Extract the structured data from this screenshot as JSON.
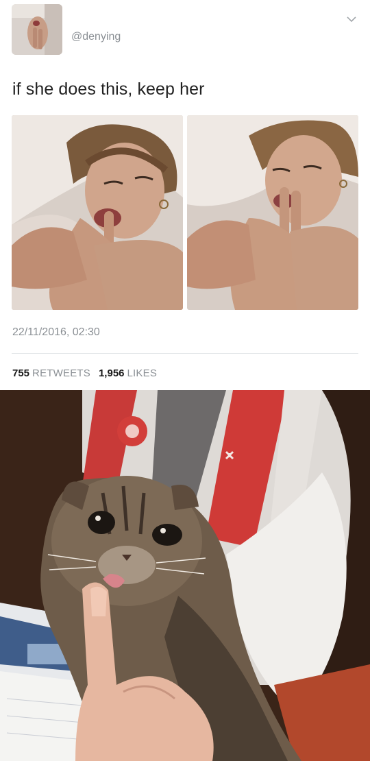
{
  "tweet": {
    "handle": "@denying",
    "text": "if she does this, keep her",
    "timestamp": "22/11/2016, 02:30",
    "retweets_count": "755",
    "retweets_label": "RETWEETS",
    "likes_count": "1,956",
    "likes_label": "LIKES"
  },
  "icons": {
    "menu": "chevron-down-icon"
  },
  "colors": {
    "secondary_text": "#8a8f94",
    "divider": "#e3e6e8"
  }
}
